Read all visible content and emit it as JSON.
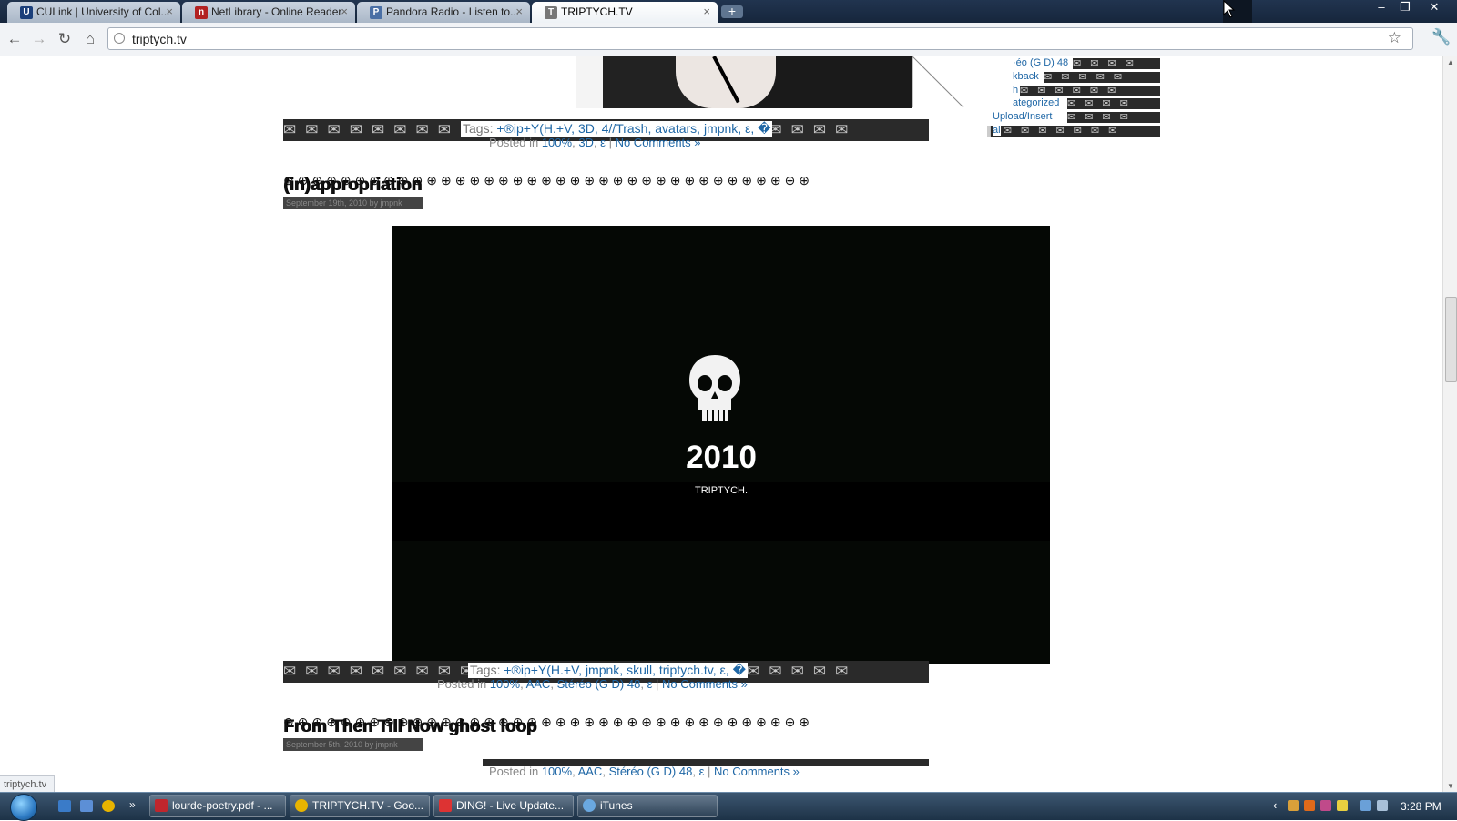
{
  "browser": {
    "tabs": [
      {
        "title": "CULink | University of Col...",
        "icon": "university-favicon",
        "color": "#1b3f7a"
      },
      {
        "title": "NetLibrary - Online Reader",
        "icon": "netlibrary-favicon",
        "color": "#b22222"
      },
      {
        "title": "Pandora Radio - Listen to...",
        "icon": "pandora-favicon",
        "color": "#4a6fa5"
      },
      {
        "title": "TRIPTYCH.TV",
        "icon": "triptych-favicon",
        "color": "#555555"
      }
    ],
    "new_tab_label": "+",
    "url": "triptych.tv",
    "status_url": "triptych.tv"
  },
  "page": {
    "posts": [
      {
        "tags_label": "Tags:",
        "tags": [
          "+®ip+Y(H.+V",
          "3D",
          "4//Trash",
          "avatars",
          "jmpnk",
          "ε",
          "�"
        ],
        "posted_in_label": "Posted in",
        "categories": [
          "100%",
          "3D",
          "ε"
        ],
        "comments": "No Comments »"
      },
      {
        "title": "(in)appropriation",
        "meta": "September 19th, 2010 by jmpnk",
        "video_year": "2010",
        "video_caption": "TRIPTYCH.",
        "tags_label": "Tags:",
        "tags": [
          "+®ip+Y(H.+V",
          "jmpnk",
          "skull",
          "triptych.tv",
          "ε",
          "�"
        ],
        "posted_in_label": "Posted in",
        "categories": [
          "100%",
          "AAC",
          "Stéréo (G D) 48",
          "ε"
        ],
        "comments": "No Comments »"
      },
      {
        "title": "From Then Till Now ghost loop",
        "meta": "September 5th, 2010 by jmpnk",
        "posted_in_label": "Posted in",
        "categories": [
          "100%",
          "AAC",
          "Stéréo (G D) 48",
          "ε"
        ],
        "comments": "No Comments »"
      }
    ],
    "sidebar": [
      "·éo (G D) 48",
      "kback",
      "h",
      "ategorized",
      "Upload/Insert",
      "ai"
    ]
  },
  "taskbar": {
    "items": [
      {
        "label": "lourde-poetry.pdf - ...",
        "icon": "pdf-icon",
        "color": "#c0262d"
      },
      {
        "label": "TRIPTYCH.TV - Goo...",
        "icon": "chrome-icon",
        "color": "#e8b400"
      },
      {
        "label": "DING! - Live Update...",
        "icon": "ding-icon",
        "color": "#d33"
      },
      {
        "label": "iTunes",
        "icon": "itunes-icon",
        "color": "#6aa8e0"
      }
    ],
    "clock": "3:28 PM"
  }
}
